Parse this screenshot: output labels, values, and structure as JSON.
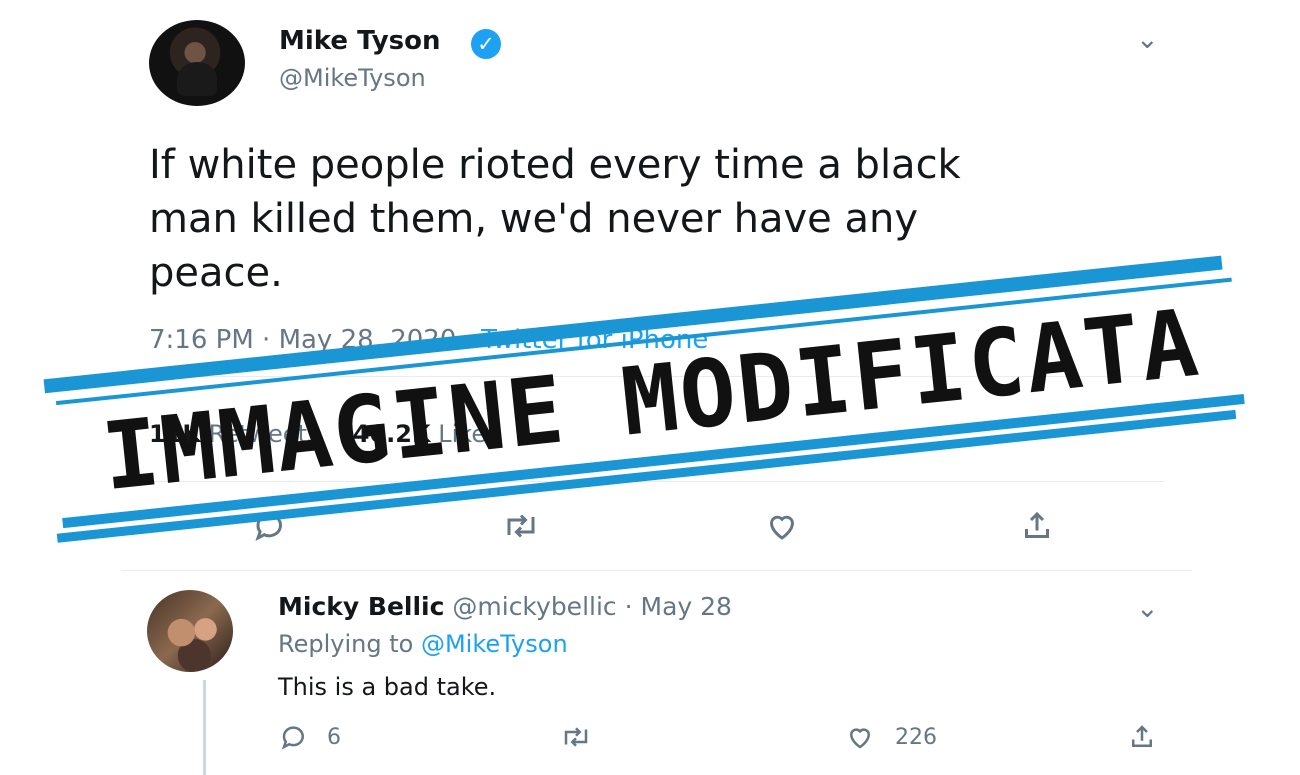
{
  "tweet": {
    "author_name": "Mike Tyson",
    "handle": "@MikeTyson",
    "text": "If white people rioted every time a black\nman killed them, we'd never have any\npeace.",
    "time": "7:16 PM",
    "date": "May 28, 2020",
    "source": "Twitter for iPhone",
    "retweets_count": "11K",
    "retweets_label": "Retweets",
    "likes_count": "40.2K",
    "likes_label": "Likes",
    "verified_icon": "verified-icon",
    "menu_icon": "chevron-down-icon",
    "actions": [
      "reply-icon",
      "retweet-icon",
      "like-icon",
      "share-icon"
    ]
  },
  "reply": {
    "author_name": "Micky Bellic",
    "handle": "@mickybellic",
    "date": "May 28",
    "replying_prefix": "Replying to",
    "replying_to": "@MikeTyson",
    "text": "This is a bad take.",
    "reply_count": "6",
    "retweet_count": "",
    "like_count": "226"
  },
  "stamp": {
    "text": "IMMAGINE MODIFICATA",
    "color": "#1a96d4",
    "ink_color": "#111111"
  },
  "colors": {
    "link": "#1da1f2",
    "secondary_text": "#657786",
    "divider": "#e6ecf0"
  }
}
